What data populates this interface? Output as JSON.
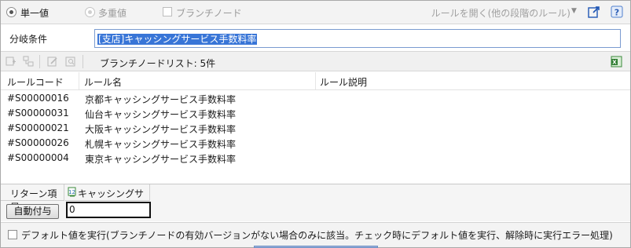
{
  "options": {
    "single_value_label": "単一値",
    "multi_value_label": "多重値",
    "branch_node_label": "ブランチノード",
    "rule_open_label": "ルールを開く(他の段階のルール)"
  },
  "condition": {
    "label": "分岐条件",
    "value": "[支店]キャッシングサービス手数料率"
  },
  "toolbar": {
    "list_title": "ブランチノードリスト: 5件"
  },
  "table": {
    "columns": [
      "ルールコード",
      "ルール名",
      "ルール説明"
    ],
    "rows": [
      {
        "code": "#S00000016",
        "name": "京都キャッシングサービス手数料率",
        "desc": ""
      },
      {
        "code": "#S00000031",
        "name": "仙台キャッシングサービス手数料率",
        "desc": ""
      },
      {
        "code": "#S00000021",
        "name": "大阪キャッシングサービス手数料率",
        "desc": ""
      },
      {
        "code": "#S00000026",
        "name": "札幌キャッシングサービス手数料率",
        "desc": ""
      },
      {
        "code": "#S00000004",
        "name": "東京キャッシングサービス手数料率",
        "desc": ""
      }
    ]
  },
  "return": {
    "header_label": "リターン項目",
    "column_label": "キャッシングサービス",
    "auto_button_label": "自動付与",
    "value": "0"
  },
  "footer": {
    "default_text": "デフォルト値を実行(ブランチノードの有効バージョンがない場合のみに該当。チェック時にデフォルト値を実行、解除時に実行エラー処理)"
  },
  "colors": {
    "selection": "#3875d7",
    "link_icon": "#1f56b4"
  }
}
